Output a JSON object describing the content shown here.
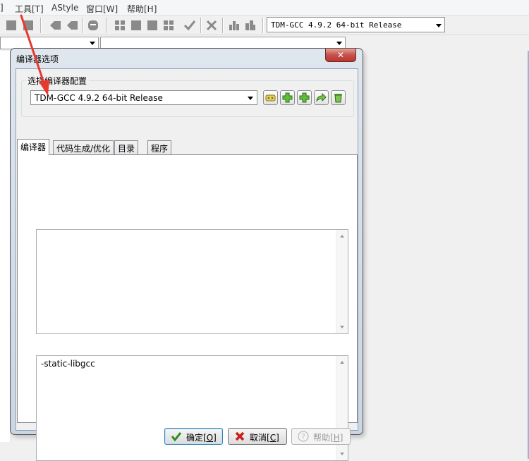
{
  "menu": {
    "items": [
      {
        "id": "partial",
        "label": "]"
      },
      {
        "id": "tools",
        "label": "工具[T]"
      },
      {
        "id": "astyle",
        "label": "AStyle"
      },
      {
        "id": "window",
        "label": "窗口[W]"
      },
      {
        "id": "help",
        "label": "帮助[H]"
      }
    ]
  },
  "toolbar": {
    "compiler_combo_value": "TDM-GCC 4.9.2 64-bit Release"
  },
  "dialog": {
    "title": "编译器选项",
    "close_label": "✕",
    "group_label": "选择编译器配置",
    "config_combo_value": "TDM-GCC 4.9.2 64-bit Release",
    "config_buttons": [
      {
        "name": "rename-config-icon"
      },
      {
        "name": "add-config-icon"
      },
      {
        "name": "add-config-copy-icon"
      },
      {
        "name": "export-config-icon"
      },
      {
        "name": "delete-config-icon"
      }
    ],
    "tabs": [
      {
        "label": "编译器"
      },
      {
        "label": "代码生成/优化"
      },
      {
        "label": "目录"
      },
      {
        "label": "程序"
      }
    ],
    "compile_cmd_text": "",
    "link_cmd_text": "-static-libgcc",
    "buttons": {
      "ok_label": "确定",
      "ok_key": "[O]",
      "cancel_label": "取消",
      "cancel_key": "[C]",
      "help_label": "帮助",
      "help_key": "[H]"
    }
  },
  "colors": {
    "annotation_arrow": "#e8392f",
    "close_button": "#c75050"
  }
}
